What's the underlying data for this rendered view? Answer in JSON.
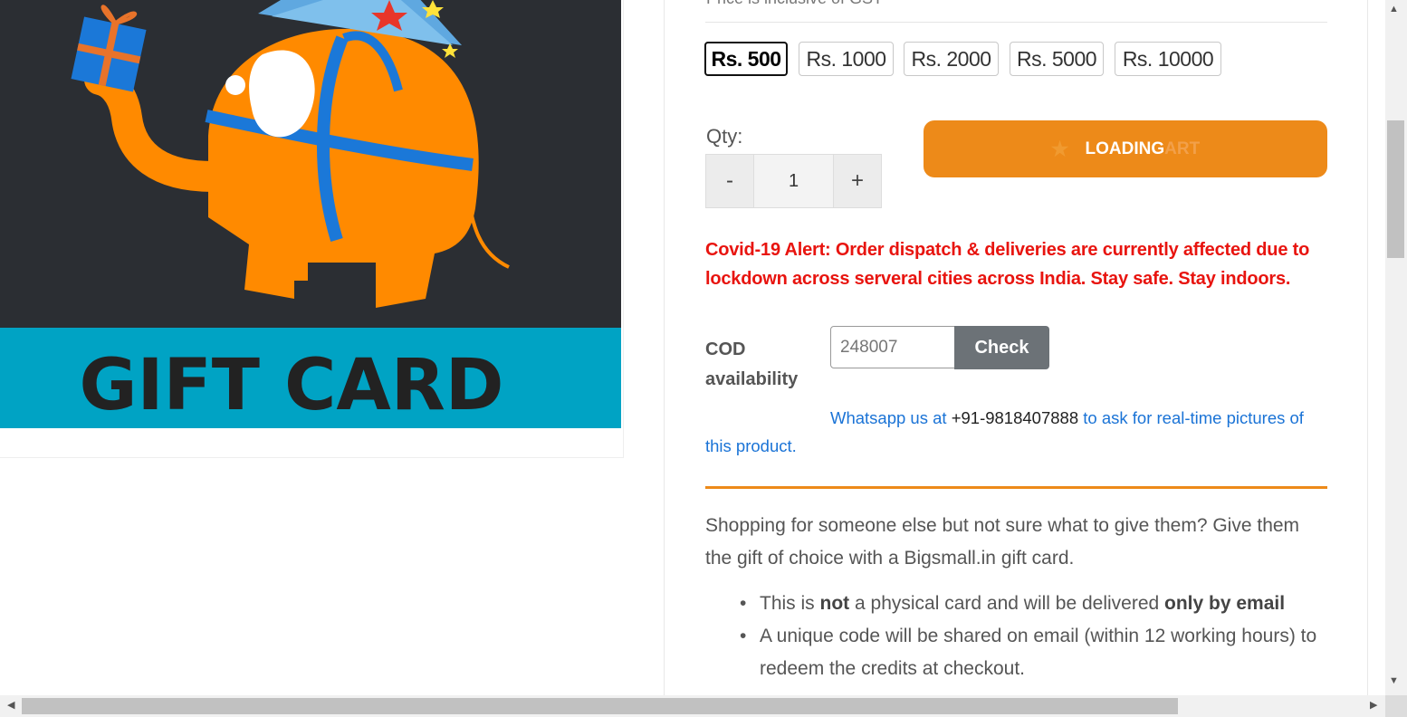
{
  "page": {
    "top_partial_text": "Price is inclusive of GST"
  },
  "product_image": {
    "card_text": "GIFT CARD"
  },
  "variants": {
    "items": [
      {
        "label": "Rs. 500",
        "selected": true
      },
      {
        "label": "Rs. 1000",
        "selected": false
      },
      {
        "label": "Rs. 2000",
        "selected": false
      },
      {
        "label": "Rs. 5000",
        "selected": false
      },
      {
        "label": "Rs. 10000",
        "selected": false
      }
    ]
  },
  "quantity": {
    "label": "Qty:",
    "decrement": "-",
    "value": "1",
    "increment": "+"
  },
  "cart_button": {
    "label": "LOADING",
    "ghost_text": "ART",
    "icon": "star-icon"
  },
  "alert": {
    "text": "Covid-19 Alert: Order dispatch & deliveries are currently affected due to lockdown across serveral cities across India. Stay safe. Stay indoors."
  },
  "cod": {
    "label": "COD availability",
    "pincode_value": "248007",
    "check_label": "Check"
  },
  "whatsapp": {
    "prefix": "Whatsapp us at ",
    "phone": "+91-9818407888",
    "suffix": " to ask for real-time pictures of this product."
  },
  "description": {
    "intro": "Shopping for someone else but not sure what to give them? Give them the gift of choice with a Bigsmall.in gift card.",
    "bullet1_a": "This is ",
    "bullet1_b": "not",
    "bullet1_c": " a physical card and will be delivered ",
    "bullet1_d": "only by email",
    "bullet2": "A unique code will be shared on email (within 12 working hours) to redeem the credits at checkout."
  },
  "colors": {
    "accent_orange": "#ed8a19",
    "alert_red": "#e8140f",
    "link_blue": "#1a73d6",
    "card_teal": "#00a3c4",
    "image_bg": "#2b2e33"
  }
}
